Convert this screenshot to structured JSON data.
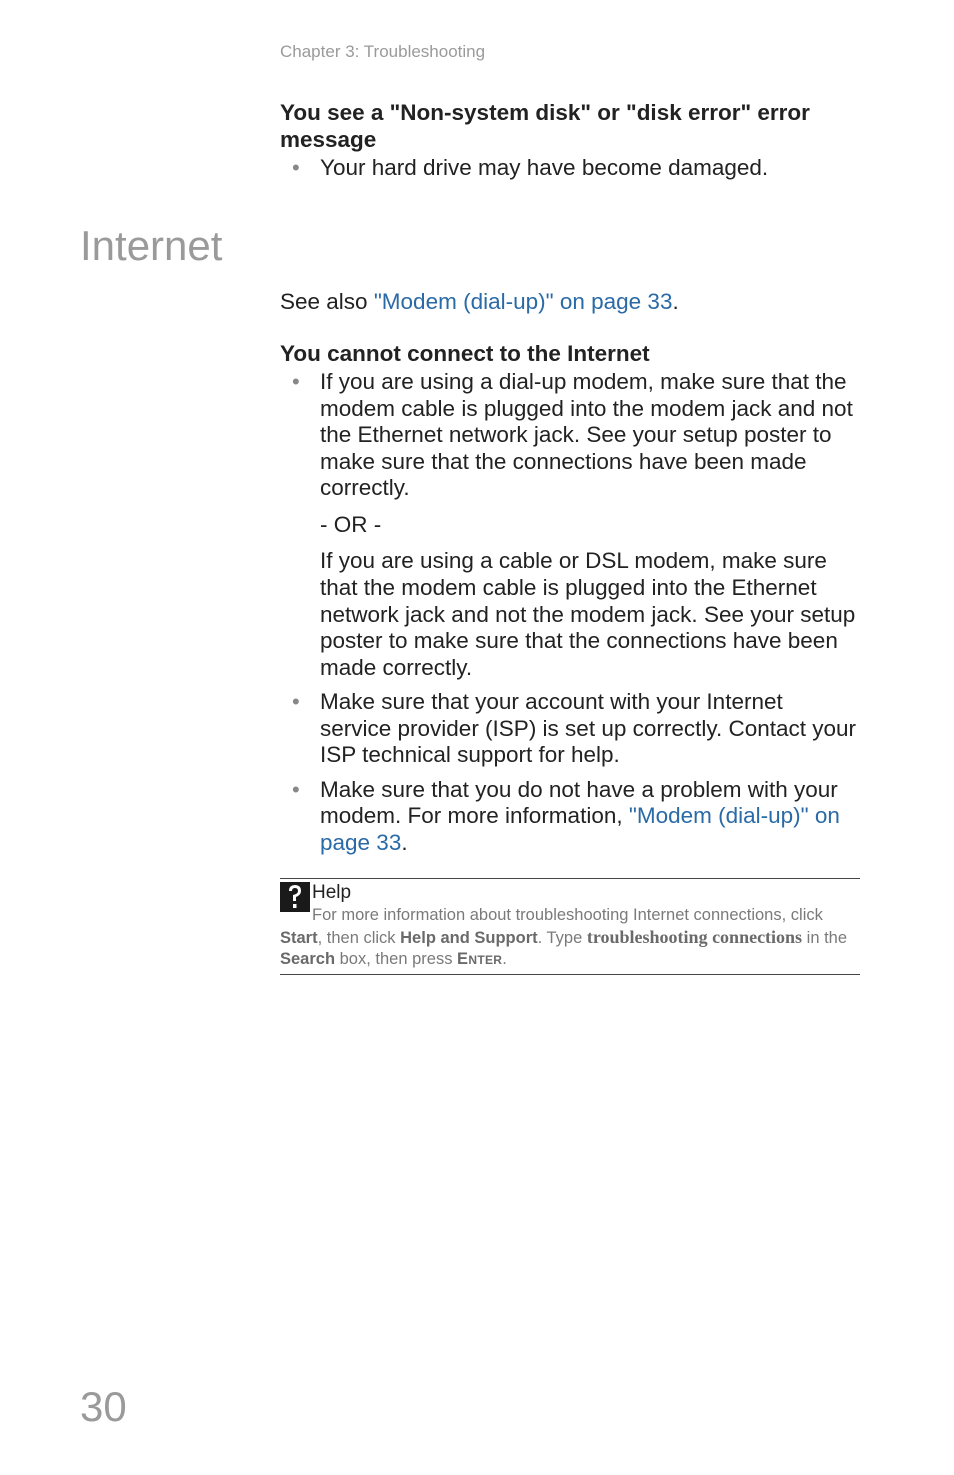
{
  "header": {
    "chapter": "Chapter 3: Troubleshooting"
  },
  "block1": {
    "heading": "You see a \"Non-system disk\" or \"disk error\" error message",
    "bullet1": "Your hard drive may have become damaged."
  },
  "section": {
    "title": "Internet"
  },
  "see_also": {
    "prefix": "See also ",
    "link": "\"Modem (dial-up)\" on page 33",
    "suffix": "."
  },
  "block2": {
    "heading": "You cannot connect to the Internet",
    "bullet1": "If you are using a dial-up modem, make sure that the modem cable is plugged into the modem jack and not the Ethernet network jack. See your setup poster to make sure that the connections have been made correctly.",
    "or": "- OR -",
    "bullet1b": "If you are using a cable or DSL modem, make sure that the modem cable is plugged into the Ethernet network jack and not the modem jack. See your setup poster to make sure that the connections have been made correctly.",
    "bullet2": "Make sure that your account with your Internet service provider (ISP) is set up correctly. Contact your ISP technical support for help.",
    "bullet3_pre": "Make sure that you do not have a problem with your modem. For more information, ",
    "bullet3_link": "\"Modem (dial-up)\" on page 33",
    "bullet3_post": "."
  },
  "help": {
    "title": "Help",
    "line1_pre": "For more information about troubleshooting Internet connections, click ",
    "start": "Start",
    "mid1": ", then click ",
    "has": "Help and Support",
    "mid2": ". Type ",
    "kw": "troubleshooting connections",
    "mid3": " in the ",
    "search": "Search",
    "mid4": " box, then press ",
    "enter": "Enter",
    "end": "."
  },
  "page_number": "30"
}
